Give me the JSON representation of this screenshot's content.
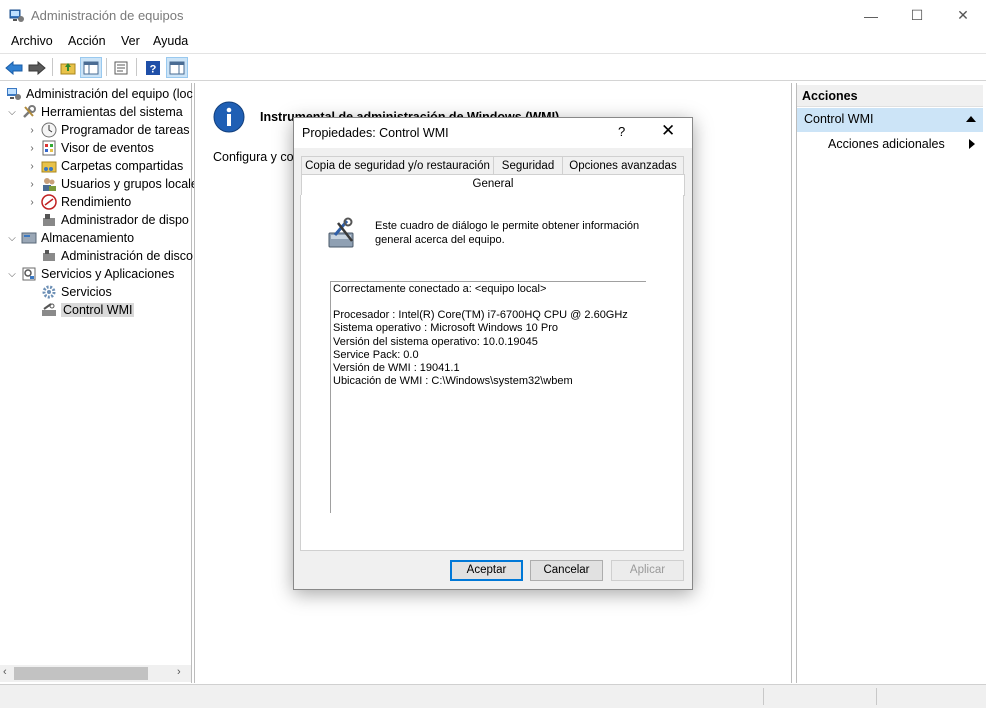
{
  "window": {
    "title": "Administración de equipos",
    "minimize_glyph": "—",
    "maximize_glyph": "☐",
    "close_glyph": "✕"
  },
  "menu": [
    "Archivo",
    "Acción",
    "Ver",
    "Ayuda"
  ],
  "toolbar": {
    "back": "back-arrow-icon",
    "forward": "forward-arrow-icon",
    "up": "folder-up-icon",
    "show_hide_tree": "console-tree-icon",
    "properties": "properties-icon",
    "help": "help-icon",
    "show_hide_actions": "action-pane-icon"
  },
  "tree": {
    "root": "Administración del equipo (loc",
    "system_tools": "Herramientas del sistema",
    "task_scheduler": "Programador de tareas",
    "event_viewer": "Visor de eventos",
    "shared_folders": "Carpetas compartidas",
    "local_users": "Usuarios y grupos locale",
    "performance": "Rendimiento",
    "device_manager": "Administrador de dispo",
    "storage": "Almacenamiento",
    "disk_management": "Administración de disco",
    "services_apps": "Servicios y Aplicaciones",
    "services": "Servicios",
    "wmi_control": "Control WMI"
  },
  "center": {
    "heading": "Instrumental de administración de Windows (WMI)",
    "description": "Configura y co"
  },
  "actions": {
    "header": "Acciones",
    "section": "Control WMI",
    "more": "Acciones adicionales"
  },
  "dialog": {
    "title": "Propiedades: Control WMI",
    "help": "?",
    "close": "✕",
    "tabs": {
      "backup": "Copia de seguridad y/o restauración",
      "security": "Seguridad",
      "advanced": "Opciones avanzadas",
      "general": "General"
    },
    "intro": "Este cuadro de diálogo le permite obtener información general acerca del equipo.",
    "info": {
      "connected": "Correctamente conectado a: <equipo local>",
      "processor": "Procesador :  Intel(R) Core(TM) i7-6700HQ CPU @ 2.60GHz",
      "os": "Sistema operativo :  Microsoft Windows 10 Pro",
      "os_version": "Versión del sistema operativo: 10.0.19045",
      "service_pack": "Service Pack: 0.0",
      "wmi_version": "Versión de WMI :  19041.1",
      "wmi_location": "Ubicación de WMI :  C:\\Windows\\system32\\wbem"
    },
    "buttons": {
      "ok": "Aceptar",
      "cancel": "Cancelar",
      "apply": "Aplicar"
    }
  },
  "colors": {
    "selection": "#cce4f7",
    "default_button_border": "#0078d7",
    "info_icon": "#1f5fb4"
  }
}
